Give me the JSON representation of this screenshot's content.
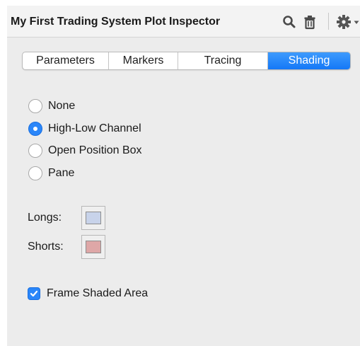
{
  "window": {
    "title": "My First Trading System Plot Inspector"
  },
  "toolbar": {
    "icons": [
      "search-icon",
      "trash-icon",
      "gear-icon",
      "chevron-down-icon"
    ]
  },
  "tabs": [
    {
      "label": "Parameters",
      "selected": false
    },
    {
      "label": "Markers",
      "selected": false
    },
    {
      "label": "Tracing",
      "selected": false
    },
    {
      "label": "Shading",
      "selected": true
    }
  ],
  "shading_options": [
    {
      "label": "None",
      "selected": false
    },
    {
      "label": "High-Low Channel",
      "selected": true
    },
    {
      "label": "Open Position Box",
      "selected": false
    },
    {
      "label": "Pane",
      "selected": false
    }
  ],
  "colors": {
    "longs_label": "Longs:",
    "longs_color": "#c8d3ea",
    "shorts_label": "Shorts:",
    "shorts_color": "#dea7a7"
  },
  "frame_shaded_area": {
    "label": "Frame Shaded Area",
    "checked": true
  },
  "theme": {
    "accent": "#1478f7"
  }
}
